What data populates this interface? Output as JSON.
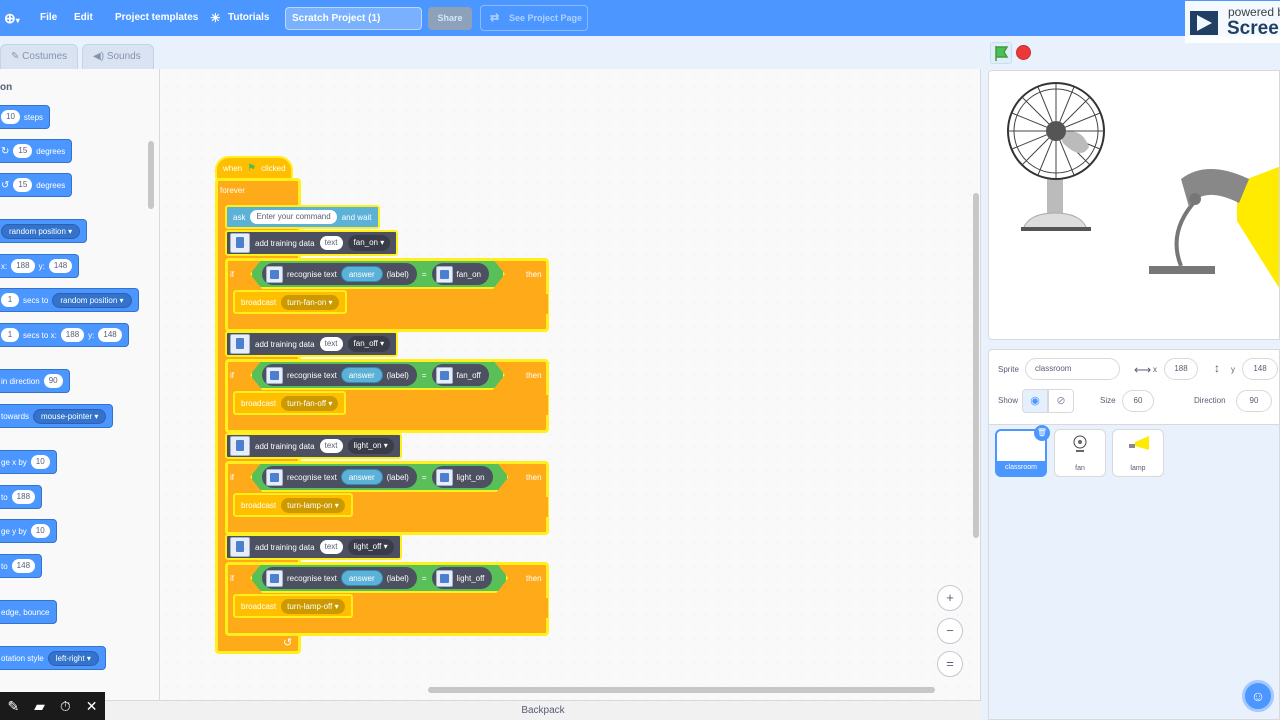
{
  "menu": {
    "file": "File",
    "edit": "Edit",
    "templates": "Project templates",
    "tutorials": "Tutorials",
    "project_title": "Scratch Project (1)",
    "share": "Share",
    "see_project_page": "See Project Page"
  },
  "watermark": {
    "line1": "powered b",
    "line2": "Screen"
  },
  "tabs": {
    "costumes": "Costumes",
    "sounds": "Sounds"
  },
  "palette": {
    "category_title": "on",
    "blocks": [
      {
        "pre": "",
        "val1": "10",
        "post": "steps"
      },
      {
        "pre": "↻",
        "val1": "15",
        "post": "degrees"
      },
      {
        "pre": "↺",
        "val1": "15",
        "post": "degrees"
      },
      {
        "drop": "random position"
      },
      {
        "x_label": "x:",
        "x": "188",
        "y_label": "y:",
        "y": "148"
      },
      {
        "val1": "1",
        "mid": "secs to",
        "drop": "random position"
      },
      {
        "val1": "1",
        "mid": "secs to x:",
        "x": "188",
        "y_label": "y:",
        "y": "148"
      },
      {
        "text": "in direction",
        "val1": "90"
      },
      {
        "text": "towards",
        "drop": "mouse-pointer"
      },
      {
        "text": "ge x by",
        "val1": "10"
      },
      {
        "text": "to",
        "val1": "188"
      },
      {
        "text": "ge y by",
        "val1": "10"
      },
      {
        "text": "to",
        "val1": "148"
      },
      {
        "text": "edge, bounce"
      },
      {
        "text": "otation style",
        "drop": "left-right"
      }
    ]
  },
  "script": {
    "hat": {
      "when": "when",
      "clicked": "clicked"
    },
    "forever": "forever",
    "ask": {
      "ask": "ask",
      "prompt": "Enter your command",
      "and_wait": "and wait"
    },
    "groups": [
      {
        "add": "add training data",
        "text": "text",
        "label": "fan_on",
        "if": "if",
        "recognise": "recognise text",
        "answer": "answer",
        "label_kw": "(label)",
        "eq": "=",
        "cmp": "fan_on",
        "then": "then",
        "broadcast": "broadcast",
        "msg": "turn-fan-on"
      },
      {
        "add": "add training data",
        "text": "text",
        "label": "fan_off",
        "if": "if",
        "recognise": "recognise text",
        "answer": "answer",
        "label_kw": "(label)",
        "eq": "=",
        "cmp": "fan_off",
        "then": "then",
        "broadcast": "broadcast",
        "msg": "turn-fan-off"
      },
      {
        "add": "add training data",
        "text": "text",
        "label": "light_on",
        "if": "if",
        "recognise": "recognise text",
        "answer": "answer",
        "label_kw": "(label)",
        "eq": "=",
        "cmp": "light_on",
        "then": "then",
        "broadcast": "broadcast",
        "msg": "turn-lamp-on"
      },
      {
        "add": "add training data",
        "text": "text",
        "label": "light_off",
        "if": "if",
        "recognise": "recognise text",
        "answer": "answer",
        "label_kw": "(label)",
        "eq": "=",
        "cmp": "light_off",
        "then": "then",
        "broadcast": "broadcast",
        "msg": "turn-lamp-off"
      }
    ]
  },
  "zoom": {
    "in": "+",
    "out": "−",
    "reset": "="
  },
  "sprite": {
    "label": "Sprite",
    "name": "classroom",
    "x_label": "x",
    "x": "188",
    "y_label": "y",
    "y": "148",
    "show_label": "Show",
    "size_label": "Size",
    "size": "60",
    "direction_label": "Direction",
    "direction": "90"
  },
  "sprites": [
    {
      "name": "classroom"
    },
    {
      "name": "fan"
    },
    {
      "name": "lamp"
    }
  ],
  "backpack": "Backpack",
  "colors": {
    "menu_blue": "#4c97ff",
    "events": "#ffbf00",
    "control": "#ffab19",
    "sensing": "#5cb1d6",
    "operators": "#59c059",
    "ml": "#4c5060",
    "highlight": "#ffef1a"
  }
}
